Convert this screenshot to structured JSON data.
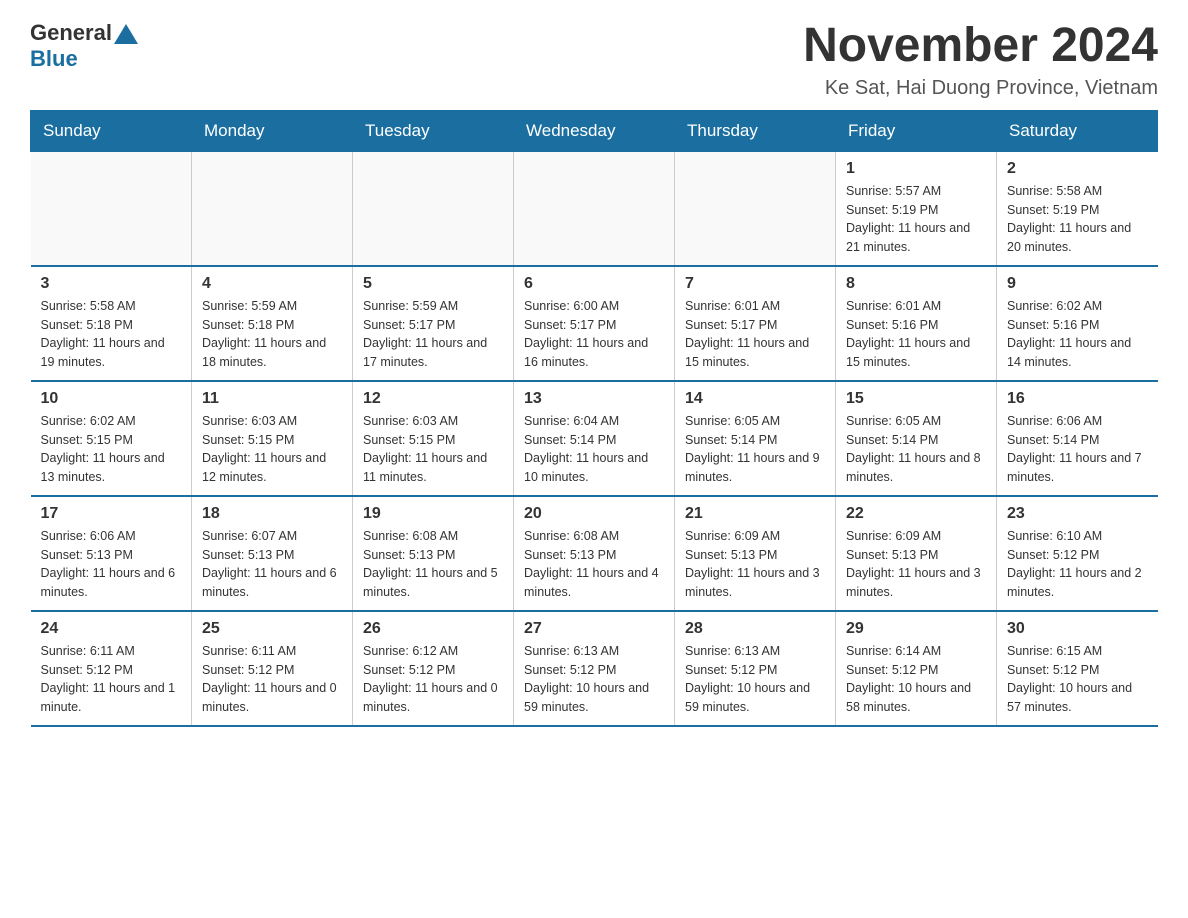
{
  "header": {
    "logo_general": "General",
    "logo_blue": "Blue",
    "title": "November 2024",
    "subtitle": "Ke Sat, Hai Duong Province, Vietnam"
  },
  "days_of_week": [
    "Sunday",
    "Monday",
    "Tuesday",
    "Wednesday",
    "Thursday",
    "Friday",
    "Saturday"
  ],
  "weeks": [
    {
      "days": [
        {
          "number": "",
          "empty": true
        },
        {
          "number": "",
          "empty": true
        },
        {
          "number": "",
          "empty": true
        },
        {
          "number": "",
          "empty": true
        },
        {
          "number": "",
          "empty": true
        },
        {
          "number": "1",
          "sunrise": "Sunrise: 5:57 AM",
          "sunset": "Sunset: 5:19 PM",
          "daylight": "Daylight: 11 hours and 21 minutes."
        },
        {
          "number": "2",
          "sunrise": "Sunrise: 5:58 AM",
          "sunset": "Sunset: 5:19 PM",
          "daylight": "Daylight: 11 hours and 20 minutes."
        }
      ]
    },
    {
      "days": [
        {
          "number": "3",
          "sunrise": "Sunrise: 5:58 AM",
          "sunset": "Sunset: 5:18 PM",
          "daylight": "Daylight: 11 hours and 19 minutes."
        },
        {
          "number": "4",
          "sunrise": "Sunrise: 5:59 AM",
          "sunset": "Sunset: 5:18 PM",
          "daylight": "Daylight: 11 hours and 18 minutes."
        },
        {
          "number": "5",
          "sunrise": "Sunrise: 5:59 AM",
          "sunset": "Sunset: 5:17 PM",
          "daylight": "Daylight: 11 hours and 17 minutes."
        },
        {
          "number": "6",
          "sunrise": "Sunrise: 6:00 AM",
          "sunset": "Sunset: 5:17 PM",
          "daylight": "Daylight: 11 hours and 16 minutes."
        },
        {
          "number": "7",
          "sunrise": "Sunrise: 6:01 AM",
          "sunset": "Sunset: 5:17 PM",
          "daylight": "Daylight: 11 hours and 15 minutes."
        },
        {
          "number": "8",
          "sunrise": "Sunrise: 6:01 AM",
          "sunset": "Sunset: 5:16 PM",
          "daylight": "Daylight: 11 hours and 15 minutes."
        },
        {
          "number": "9",
          "sunrise": "Sunrise: 6:02 AM",
          "sunset": "Sunset: 5:16 PM",
          "daylight": "Daylight: 11 hours and 14 minutes."
        }
      ]
    },
    {
      "days": [
        {
          "number": "10",
          "sunrise": "Sunrise: 6:02 AM",
          "sunset": "Sunset: 5:15 PM",
          "daylight": "Daylight: 11 hours and 13 minutes."
        },
        {
          "number": "11",
          "sunrise": "Sunrise: 6:03 AM",
          "sunset": "Sunset: 5:15 PM",
          "daylight": "Daylight: 11 hours and 12 minutes."
        },
        {
          "number": "12",
          "sunrise": "Sunrise: 6:03 AM",
          "sunset": "Sunset: 5:15 PM",
          "daylight": "Daylight: 11 hours and 11 minutes."
        },
        {
          "number": "13",
          "sunrise": "Sunrise: 6:04 AM",
          "sunset": "Sunset: 5:14 PM",
          "daylight": "Daylight: 11 hours and 10 minutes."
        },
        {
          "number": "14",
          "sunrise": "Sunrise: 6:05 AM",
          "sunset": "Sunset: 5:14 PM",
          "daylight": "Daylight: 11 hours and 9 minutes."
        },
        {
          "number": "15",
          "sunrise": "Sunrise: 6:05 AM",
          "sunset": "Sunset: 5:14 PM",
          "daylight": "Daylight: 11 hours and 8 minutes."
        },
        {
          "number": "16",
          "sunrise": "Sunrise: 6:06 AM",
          "sunset": "Sunset: 5:14 PM",
          "daylight": "Daylight: 11 hours and 7 minutes."
        }
      ]
    },
    {
      "days": [
        {
          "number": "17",
          "sunrise": "Sunrise: 6:06 AM",
          "sunset": "Sunset: 5:13 PM",
          "daylight": "Daylight: 11 hours and 6 minutes."
        },
        {
          "number": "18",
          "sunrise": "Sunrise: 6:07 AM",
          "sunset": "Sunset: 5:13 PM",
          "daylight": "Daylight: 11 hours and 6 minutes."
        },
        {
          "number": "19",
          "sunrise": "Sunrise: 6:08 AM",
          "sunset": "Sunset: 5:13 PM",
          "daylight": "Daylight: 11 hours and 5 minutes."
        },
        {
          "number": "20",
          "sunrise": "Sunrise: 6:08 AM",
          "sunset": "Sunset: 5:13 PM",
          "daylight": "Daylight: 11 hours and 4 minutes."
        },
        {
          "number": "21",
          "sunrise": "Sunrise: 6:09 AM",
          "sunset": "Sunset: 5:13 PM",
          "daylight": "Daylight: 11 hours and 3 minutes."
        },
        {
          "number": "22",
          "sunrise": "Sunrise: 6:09 AM",
          "sunset": "Sunset: 5:13 PM",
          "daylight": "Daylight: 11 hours and 3 minutes."
        },
        {
          "number": "23",
          "sunrise": "Sunrise: 6:10 AM",
          "sunset": "Sunset: 5:12 PM",
          "daylight": "Daylight: 11 hours and 2 minutes."
        }
      ]
    },
    {
      "days": [
        {
          "number": "24",
          "sunrise": "Sunrise: 6:11 AM",
          "sunset": "Sunset: 5:12 PM",
          "daylight": "Daylight: 11 hours and 1 minute."
        },
        {
          "number": "25",
          "sunrise": "Sunrise: 6:11 AM",
          "sunset": "Sunset: 5:12 PM",
          "daylight": "Daylight: 11 hours and 0 minutes."
        },
        {
          "number": "26",
          "sunrise": "Sunrise: 6:12 AM",
          "sunset": "Sunset: 5:12 PM",
          "daylight": "Daylight: 11 hours and 0 minutes."
        },
        {
          "number": "27",
          "sunrise": "Sunrise: 6:13 AM",
          "sunset": "Sunset: 5:12 PM",
          "daylight": "Daylight: 10 hours and 59 minutes."
        },
        {
          "number": "28",
          "sunrise": "Sunrise: 6:13 AM",
          "sunset": "Sunset: 5:12 PM",
          "daylight": "Daylight: 10 hours and 59 minutes."
        },
        {
          "number": "29",
          "sunrise": "Sunrise: 6:14 AM",
          "sunset": "Sunset: 5:12 PM",
          "daylight": "Daylight: 10 hours and 58 minutes."
        },
        {
          "number": "30",
          "sunrise": "Sunrise: 6:15 AM",
          "sunset": "Sunset: 5:12 PM",
          "daylight": "Daylight: 10 hours and 57 minutes."
        }
      ]
    }
  ]
}
